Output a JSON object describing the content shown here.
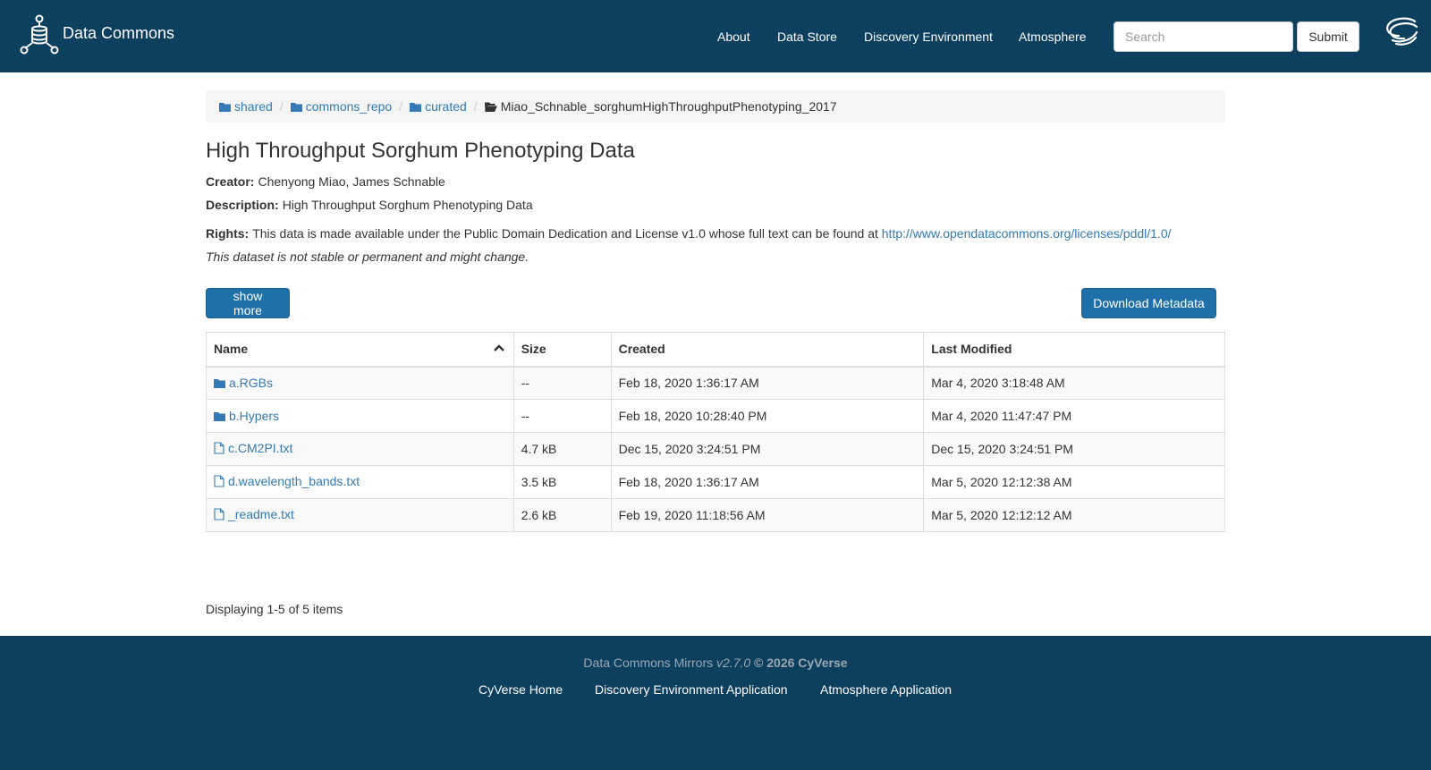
{
  "header": {
    "brand_title": "Data Commons",
    "nav": [
      "About",
      "Data Store",
      "Discovery Environment",
      "Atmosphere"
    ],
    "search_placeholder": "Search",
    "submit_label": "Submit"
  },
  "breadcrumb": {
    "items": [
      "shared",
      "commons_repo",
      "curated",
      "Miao_Schnable_sorghumHighThroughputPhenotyping_2017"
    ],
    "separator": "/"
  },
  "dataset": {
    "title": "High Throughput Sorghum Phenotyping Data",
    "creator_label": "Creator:",
    "creator": "Chenyong Miao, James Schnable",
    "description_label": "Description:",
    "description": "High Throughput Sorghum Phenotyping Data",
    "rights_label": "Rights:",
    "rights_text": "This data is made available under the Public Domain Dedication and License v1.0 whose full text can be found at",
    "rights_link": "http://www.opendatacommons.org/licenses/pddl/1.0/",
    "note": "This dataset is not stable or permanent and might change."
  },
  "actions": {
    "show_more": "show more",
    "download_metadata": "Download Metadata"
  },
  "table": {
    "headers": [
      "Name",
      "Size",
      "Created",
      "Last Modified"
    ],
    "rows": [
      {
        "type": "folder",
        "name": "a.RGBs",
        "size": "--",
        "created": "Feb 18, 2020 1:36:17 AM",
        "modified": "Mar 4, 2020 3:18:48 AM"
      },
      {
        "type": "folder",
        "name": "b.Hypers",
        "size": "--",
        "created": "Feb 18, 2020 10:28:40 PM",
        "modified": "Mar 4, 2020 11:47:47 PM"
      },
      {
        "type": "file",
        "name": "c.CM2PI.txt",
        "size": "4.7 kB",
        "created": "Dec 15, 2020 3:24:51 PM",
        "modified": "Dec 15, 2020 3:24:51 PM"
      },
      {
        "type": "file",
        "name": "d.wavelength_bands.txt",
        "size": "3.5 kB",
        "created": "Feb 18, 2020 1:36:17 AM",
        "modified": "Mar 5, 2020 12:12:38 AM"
      },
      {
        "type": "file",
        "name": "_readme.txt",
        "size": "2.6 kB",
        "created": "Feb 19, 2020 11:18:56 AM",
        "modified": "Mar 5, 2020 12:12:12 AM"
      }
    ]
  },
  "pagination": {
    "summary": "Displaying 1-5 of 5 items"
  },
  "footer": {
    "product": "Data Commons Mirrors",
    "version": "v2.7.0",
    "copyright": "© 2026 CyVerse",
    "links": [
      "CyVerse Home",
      "Discovery Environment Application",
      "Atmosphere Application"
    ]
  },
  "colors": {
    "navbar": "#0d3f5f",
    "primary_button": "#1f6fa8",
    "link": "#337ab7"
  }
}
